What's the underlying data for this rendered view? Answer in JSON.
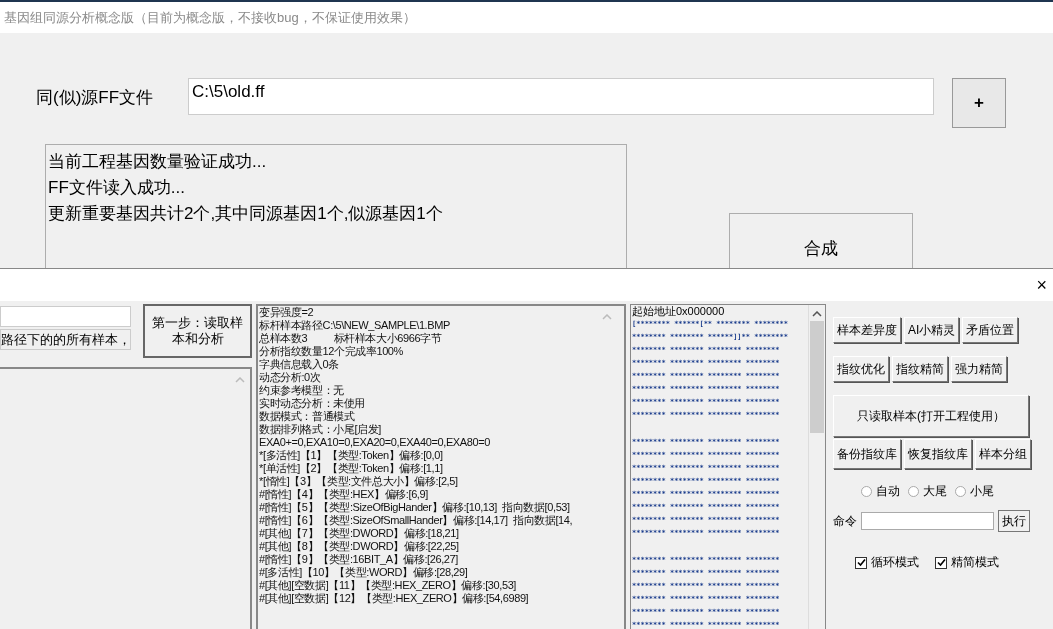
{
  "main_window": {
    "title": "基因组同源分析概念版（目前为概念版，不接收bug，不保证使用效果）",
    "source_label": "同(似)源FF文件",
    "source_path": "C:\\5\\old.ff",
    "add_button": "+",
    "log_lines": [
      "当前工程基因数量验证成功...",
      "FF文件读入成功...",
      "更新重要基因共计2个,其中同源基因1个,似源基因1个"
    ],
    "merge_button": "合成"
  },
  "analysis_window": {
    "close_button": "×",
    "path_hint": "路径下的的所有样本，",
    "step_button": "第一步：读取样本和分析",
    "report_lines": [
      "变异强度=2",
      "标杆样本路径C:\\5\\NEW_SAMPLE\\1.BMP",
      "总样本数3          标杆样本大小6966字节",
      "分析指纹数量12个完成率100%",
      "字典信息载入0条",
      "动态分析:0次",
      "约束参考模型：无",
      "实时动态分析：未使用",
      "数据模式：普通模式",
      "数据排列格式：小尾[启发]",
      "EXA0+=0,EXA10=0,EXA20=0,EXA40=0,EXA80=0",
      "*[多活性]【1】【类型:Token】偏移:[0,0]",
      "*[单活性]【2】【类型:Token】偏移:[1,1]",
      "*[惰性]【3】【类型:文件总大小】偏移:[2,5]",
      "#[惰性]【4】【类型:HEX】偏移:[6,9]",
      "#[惰性]【5】【类型:SizeOfBigHander】偏移:[10,13]  指向数据[0,53]",
      "#[惰性]【6】【类型:SizeOfSmallHander】偏移:[14,17]  指向数据[14,",
      "#[其他]【7】【类型:DWORD】偏移:[18,21]",
      "#[其他]【8】【类型:DWORD】偏移:[22,25]",
      "#[惰性]【9】【类型:16BIT_A】偏移:[26,27]",
      "#[多活性]【10】【类型:WORD】偏移:[28,29]",
      "#[其他][空数据]【11】【类型:HEX_ZERO】偏移:[30,53]",
      "#[其他][空数据]【12】【类型:HEX_ZERO】偏移:[54,6989]"
    ],
    "hex_view": {
      "header": "起始地址0x000000",
      "blocks": [
        [
          "[******** ******[** ******** ********",
          "******** ******** ******]]** ********",
          "******** ******** ******** ********",
          "******** ******** ******** ********",
          "******** ******** ******** ********",
          "******** ******** ******** ********",
          "******** ******** ******** ********",
          "******** ******** ******** ********"
        ],
        [
          "******** ******** ******** ********",
          "******** ******** ******** ********",
          "******** ******** ******** ********",
          "******** ******** ******** ********",
          "******** ******** ******** ********",
          "******** ******** ******** ********",
          "******** ******** ******** ********",
          "******** ******** ******** ********"
        ],
        [
          "******** ******** ******** ********",
          "******** ******** ******** ********",
          "******** ******** ******** ********",
          "******** ******** ******** ********",
          "******** ******** ******** ********",
          "******** ******** ******** ********"
        ]
      ]
    },
    "tool_rows": [
      [
        "样本差异度",
        "AI小精灵",
        "矛盾位置"
      ],
      [
        "指纹优化",
        "指纹精简",
        "强力精简"
      ],
      [
        "只读取样本(打开工程使用）"
      ],
      [
        "备份指纹库",
        "恢复指纹库",
        "样本分组"
      ]
    ],
    "byte_order": [
      {
        "label": "自动",
        "selected": false
      },
      {
        "label": "大尾",
        "selected": false
      },
      {
        "label": "小尾",
        "selected": false
      }
    ],
    "command_label": "命令",
    "run_button": "执行",
    "options": [
      {
        "label": "循环模式",
        "checked": true
      },
      {
        "label": "精简模式",
        "checked": true
      }
    ]
  }
}
